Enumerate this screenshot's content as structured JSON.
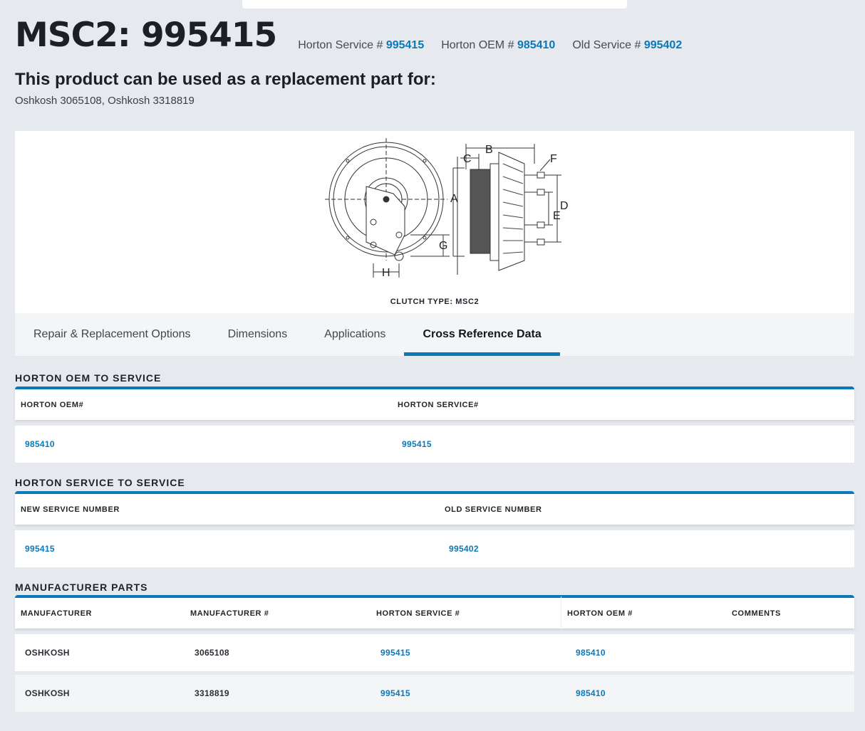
{
  "header": {
    "title": "MSC2: 995415",
    "service_label": "Horton Service #",
    "service_value": "995415",
    "oem_label": "Horton OEM #",
    "oem_value": "985410",
    "old_label": "Old Service #",
    "old_value": "995402"
  },
  "replacement": {
    "heading": "This product can be used as a replacement part for:",
    "parts": "Oshkosh 3065108, Oshkosh 3318819"
  },
  "diagram": {
    "caption": "CLUTCH TYPE: MSC2",
    "labels": [
      "A",
      "B",
      "C",
      "D",
      "E",
      "F",
      "G",
      "H"
    ]
  },
  "tabs": [
    {
      "label": "Repair & Replacement Options",
      "active": false
    },
    {
      "label": "Dimensions",
      "active": false
    },
    {
      "label": "Applications",
      "active": false
    },
    {
      "label": "Cross Reference Data",
      "active": true
    }
  ],
  "oem_to_service": {
    "title": "HORTON OEM TO SERVICE",
    "headers": [
      "HORTON OEM#",
      "HORTON SERVICE#"
    ],
    "rows": [
      [
        "985410",
        "995415"
      ]
    ]
  },
  "service_to_service": {
    "title": "HORTON SERVICE TO SERVICE",
    "headers": [
      "NEW SERVICE NUMBER",
      "OLD SERVICE NUMBER"
    ],
    "rows": [
      [
        "995415",
        "995402"
      ]
    ]
  },
  "manufacturer_parts": {
    "title": "MANUFACTURER PARTS",
    "headers": [
      "MANUFACTURER",
      "MANUFACTURER #",
      "HORTON SERVICE #",
      "HORTON OEM #",
      "COMMENTS"
    ],
    "rows": [
      [
        "OSHKOSH",
        "3065108",
        "995415",
        "985410",
        ""
      ],
      [
        "OSHKOSH",
        "3318819",
        "995415",
        "985410",
        ""
      ]
    ]
  },
  "colors": {
    "accent": "#0a79b8",
    "page_bg": "#e6e9ee",
    "text": "#1f2328"
  }
}
